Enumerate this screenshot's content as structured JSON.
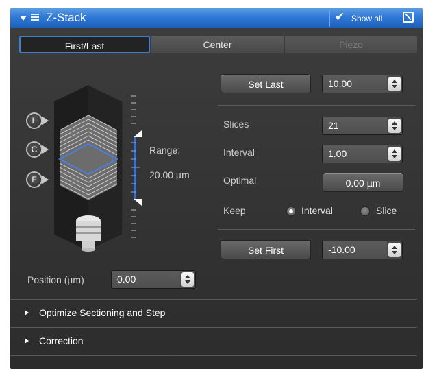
{
  "panel": {
    "title": "Z-Stack",
    "show_all_label": "Show all",
    "icons": {
      "collapse": "triangle-down-icon",
      "menu": "list-icon",
      "check": "check-icon",
      "popout": "popout-icon"
    }
  },
  "tabs": [
    {
      "label": "First/Last",
      "state": "selected"
    },
    {
      "label": "Center",
      "state": "enabled"
    },
    {
      "label": "Piezo",
      "state": "disabled"
    }
  ],
  "stack_graphic": {
    "markers": [
      "L",
      "C",
      "F"
    ],
    "range_label": "Range:",
    "range_value": "20.00 µm"
  },
  "position": {
    "label": "Position (µm)",
    "value": "0.00"
  },
  "set_last": {
    "button_label": "Set Last",
    "value": "10.00"
  },
  "slices": {
    "label": "Slices",
    "value": "21"
  },
  "interval": {
    "label": "Interval",
    "value": "1.00"
  },
  "optimal": {
    "label": "Optimal",
    "button_label": "0.00 µm"
  },
  "keep": {
    "label": "Keep",
    "options": [
      {
        "label": "Interval",
        "selected": true
      },
      {
        "label": "Slice",
        "selected": false
      }
    ]
  },
  "set_first": {
    "button_label": "Set First",
    "value": "-10.00"
  },
  "sections": [
    {
      "label": "Optimize Sectioning and Step",
      "expanded": false
    },
    {
      "label": "Correction",
      "expanded": false
    }
  ],
  "colors": {
    "accent": "#2f78d6",
    "panel_bg": "#333333",
    "slice_line": "#4a7fe0"
  }
}
